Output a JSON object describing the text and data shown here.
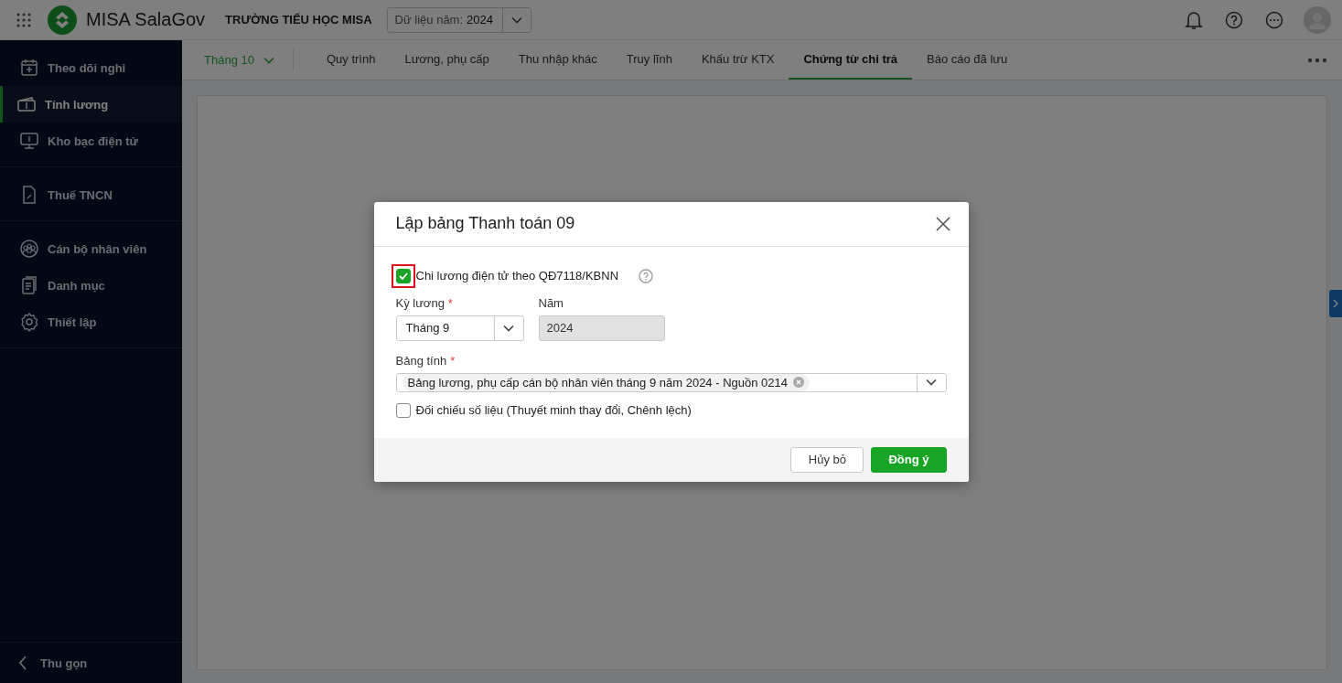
{
  "header": {
    "app_name": "MISA SalaGov",
    "org_name": "TRƯỜNG TIỂU HỌC MISA",
    "year_select": {
      "label": "Dữ liệu năm:",
      "value": "2024"
    }
  },
  "sidebar": {
    "groups": [
      [
        {
          "label": "Theo dõi nghỉ",
          "selected": false
        },
        {
          "label": "Tính lương",
          "selected": true
        },
        {
          "label": "Kho bạc điện tử",
          "selected": false
        }
      ],
      [
        {
          "label": "Thuế TNCN",
          "selected": false
        }
      ],
      [
        {
          "label": "Cán bộ nhân viên",
          "selected": false
        },
        {
          "label": "Danh mục",
          "selected": false
        },
        {
          "label": "Thiết lập",
          "selected": false
        }
      ]
    ],
    "collapse_label": "Thu gọn"
  },
  "toolbar": {
    "month": "Tháng 10",
    "tabs": [
      {
        "label": "Quy trình",
        "selected": false
      },
      {
        "label": "Lương, phụ cấp",
        "selected": false
      },
      {
        "label": "Thu nhập khác",
        "selected": false
      },
      {
        "label": "Truy lĩnh",
        "selected": false
      },
      {
        "label": "Khấu trừ KTX",
        "selected": false
      },
      {
        "label": "Chứng từ chi trả",
        "selected": true
      },
      {
        "label": "Báo cáo đã lưu",
        "selected": false
      }
    ]
  },
  "dialog": {
    "title": "Lập bảng Thanh toán 09",
    "electronic_checkbox": {
      "label": "Chi lương điện tử theo QĐ7118/KBNN",
      "checked": true,
      "highlighted": true
    },
    "period": {
      "label": "Kỳ lương",
      "required_mark": "*",
      "value": "Tháng 9"
    },
    "year": {
      "label": "Năm",
      "value": "2024",
      "disabled": true
    },
    "sheet": {
      "label": "Bảng tính",
      "required_mark": "*",
      "tags": [
        "Bảng lương, phụ cấp cán bộ nhân viên tháng 9 năm 2024 - Nguồn 0214"
      ]
    },
    "compare_checkbox": {
      "label": "Đối chiếu số liệu (Thuyết minh thay đổi, Chênh lệch)",
      "checked": false
    },
    "buttons": [
      {
        "label": "Hủy bỏ",
        "kind": "secondary"
      },
      {
        "label": "Đồng ý",
        "kind": "primary"
      }
    ]
  }
}
